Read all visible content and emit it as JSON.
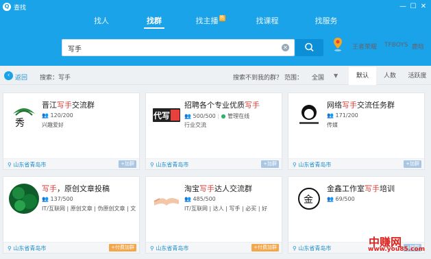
{
  "window": {
    "title": "查找",
    "app_icon": "QQ"
  },
  "tabs": [
    {
      "label": "找人",
      "active": false
    },
    {
      "label": "找群",
      "active": true
    },
    {
      "label": "找主播",
      "active": false,
      "badge": "热"
    },
    {
      "label": "找课程",
      "active": false
    },
    {
      "label": "找服务",
      "active": false
    }
  ],
  "search": {
    "value": "写手",
    "clear_icon": "clear-icon",
    "button_icon": "search-icon"
  },
  "hot_words": [
    "王者荣耀",
    "TFBOYS",
    "鹿晗"
  ],
  "filter": {
    "back": "返回",
    "crumb": "搜索：写手",
    "not_found": "搜索不到我的群？",
    "range_label": "范围：",
    "range_value": "全国",
    "sort": [
      {
        "label": "默认",
        "active": true
      },
      {
        "label": "人数",
        "active": false
      },
      {
        "label": "活跃度",
        "active": false
      }
    ]
  },
  "groups": [
    {
      "name_pre": "晋江",
      "name_hl": "写手",
      "name_post": "交流群",
      "members": "120/200",
      "tags": "兴趣爱好",
      "location": "山东省青岛市",
      "action": "+加群",
      "paid": false
    },
    {
      "name_pre": "招聘各个专业优质",
      "name_hl": "写手",
      "name_post": "",
      "members": "500/500",
      "managed": "管理在线",
      "tags": "行业交流",
      "location": "山东省青岛市",
      "action": "+加群",
      "paid": false
    },
    {
      "name_pre": "网络",
      "name_hl": "写手",
      "name_post": "交流任务群",
      "members": "171/200",
      "tags": "传媒",
      "location": "山东省青岛市",
      "action": "+加群",
      "paid": false
    },
    {
      "name_pre": "",
      "name_hl": "写手",
      "name_post": "，原创文章投稿",
      "members": "137/500",
      "tags": "IT/互联网 | 原创文章 | 伪原创文章 | 文",
      "location": "山东省青岛市",
      "action": "+付费加群",
      "paid": true
    },
    {
      "name_pre": "淘宝",
      "name_hl": "写手",
      "name_post": "达人交流群",
      "members": "485/500",
      "tags": "IT/互联网 | 达人 | 写手 | 必买 | 好",
      "location": "山东省青岛市",
      "action": "+付费加群",
      "paid": true
    },
    {
      "name_pre": "金鑫工作室",
      "name_hl": "写手",
      "name_post": "培训",
      "members": "69/500",
      "tags": "",
      "location": "山东省青岛市",
      "action": "+加群",
      "paid": false
    }
  ],
  "watermark": {
    "line1": "中赚网",
    "line2": "www.you85.com"
  },
  "colors": {
    "brand": "#1ba3ea",
    "highlight": "#e8413c",
    "paid": "#f3a64a"
  }
}
